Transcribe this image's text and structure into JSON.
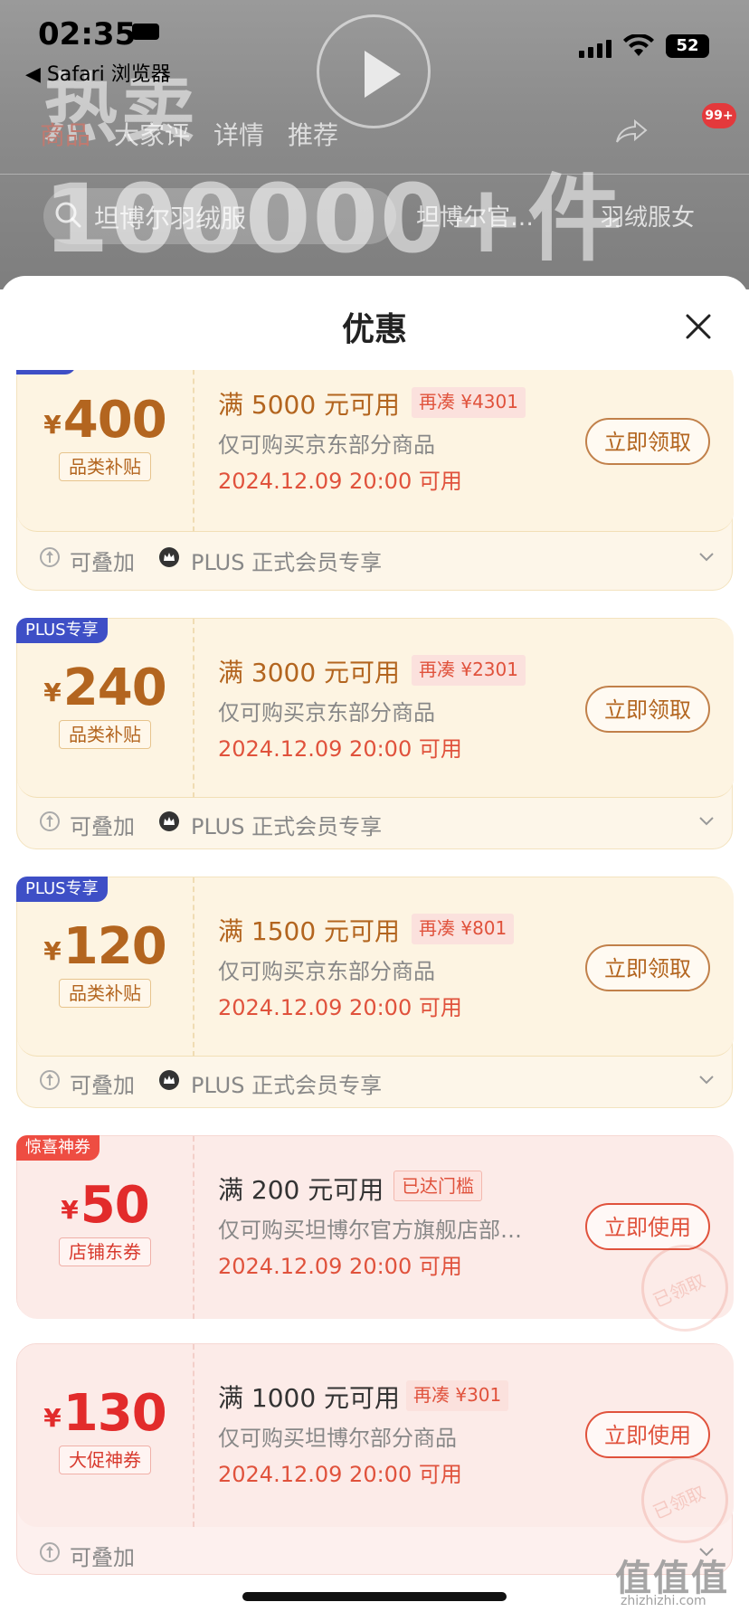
{
  "status_bar": {
    "time": "02:35",
    "back_app": "◀ Safari 浏览器",
    "battery": "52"
  },
  "background": {
    "promo_line1": "热卖",
    "promo_line2": "100000+件",
    "tabs": [
      "商品",
      "大家评",
      "详情",
      "推荐"
    ],
    "cart_badge": "99+",
    "search_text": "坦博尔羽绒服",
    "search_tags": [
      "坦博尔官…",
      "羽绒服女"
    ]
  },
  "sheet": {
    "title": "优惠"
  },
  "coupons": [
    {
      "style": "gold",
      "badge": "",
      "currency": "¥",
      "amount": "400",
      "tag": "品类补贴",
      "condition": "满 5000 元可用",
      "need": "再凑 ¥4301",
      "scope": "仅可购买京东部分商品",
      "date": "2024.12.09 20:00 可用",
      "action": "立即领取",
      "foot_stack": "可叠加",
      "foot_plus": "PLUS 正式会员专享"
    },
    {
      "style": "gold",
      "badge": "PLUS专享",
      "currency": "¥",
      "amount": "240",
      "tag": "品类补贴",
      "condition": "满 3000 元可用",
      "need": "再凑 ¥2301",
      "scope": "仅可购买京东部分商品",
      "date": "2024.12.09 20:00 可用",
      "action": "立即领取",
      "foot_stack": "可叠加",
      "foot_plus": "PLUS 正式会员专享"
    },
    {
      "style": "gold",
      "badge": "PLUS专享",
      "currency": "¥",
      "amount": "120",
      "tag": "品类补贴",
      "condition": "满 1500 元可用",
      "need": "再凑 ¥801",
      "scope": "仅可购买京东部分商品",
      "date": "2024.12.09 20:00 可用",
      "action": "立即领取",
      "foot_stack": "可叠加",
      "foot_plus": "PLUS 正式会员专享"
    },
    {
      "style": "red",
      "badge": "惊喜神券",
      "currency": "¥",
      "amount": "50",
      "tag": "店铺东券",
      "condition": "满 200 元可用",
      "need": "已达门槛",
      "scope": "仅可购买坦博尔官方旗舰店部…",
      "date": "2024.12.09 20:00 可用",
      "action": "立即使用",
      "stamp": "已领取"
    },
    {
      "style": "red",
      "badge": "",
      "currency": "¥",
      "amount": "130",
      "tag": "大促神券",
      "condition": "满 1000 元可用",
      "need": "再凑 ¥301",
      "scope": "仅可购买坦博尔部分商品",
      "date": "2024.12.09 20:00 可用",
      "action": "立即使用",
      "stamp": "已领取",
      "foot_stack": "可叠加"
    }
  ],
  "watermark": {
    "main": "值值值",
    "sub": "zhizhizhi.com"
  },
  "colors": {
    "gold_text": "#b3651f",
    "red_text": "#e22b2b",
    "plus_badge": "#3e4fc6",
    "surprise_badge": "#ee4d42"
  }
}
